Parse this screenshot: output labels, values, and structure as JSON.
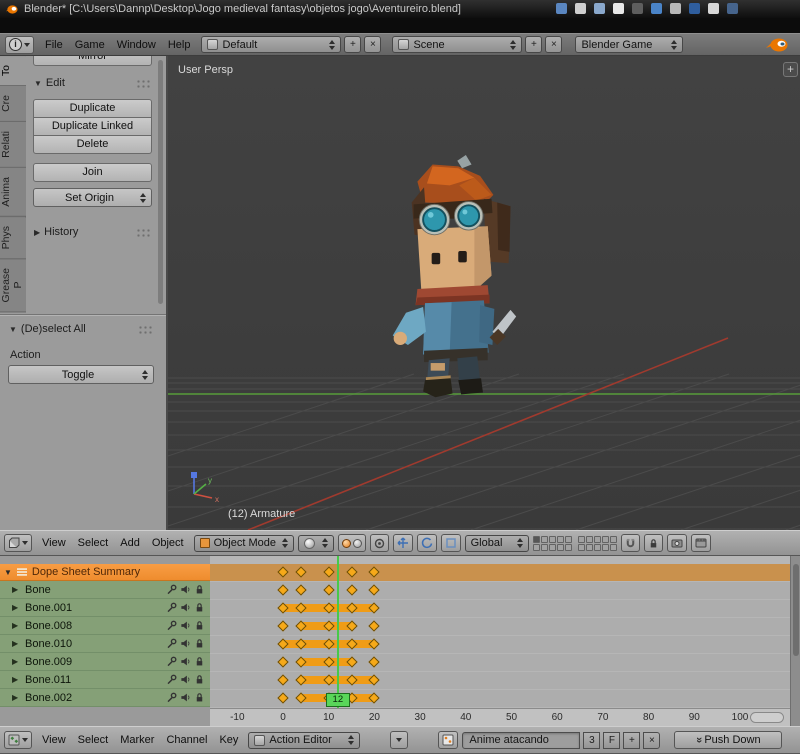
{
  "icons": {
    "expanded": "▼",
    "collapsed": "▶",
    "plus": "+",
    "close": "×",
    "push_down_arrow": "»",
    "info": "i",
    "region_plus": "+"
  },
  "titlebar": {
    "title": "Blender* [C:\\Users\\Dannp\\Desktop\\Jogo medieval fantasy\\objetos jogo\\Aventureiro.blend]"
  },
  "infobar": {
    "menus": [
      "File",
      "Game",
      "Window",
      "Help"
    ],
    "layout_value": "Default",
    "scene_value": "Scene",
    "engine_value": "Blender Game"
  },
  "toolshelf": {
    "tabs": [
      {
        "label": "To",
        "active": true
      },
      {
        "label": "Cre",
        "active": false
      },
      {
        "label": "Relati",
        "active": false
      },
      {
        "label": "Anima",
        "active": false
      },
      {
        "label": "Phys",
        "active": false
      },
      {
        "label": "Grease P",
        "active": false
      }
    ],
    "mirror_button": "Mirror",
    "edit_panel_title": "Edit",
    "edit_buttons": [
      "Duplicate",
      "Duplicate Linked",
      "Delete"
    ],
    "join_button": "Join",
    "set_origin_button": "Set Origin",
    "history_panel_title": "History",
    "redo_panel_title": "(De)select All",
    "action_label": "Action",
    "toggle_value": "Toggle"
  },
  "viewport": {
    "view_label": "User Persp",
    "active_object_label": "(12) Armature",
    "header": {
      "menus": [
        "View",
        "Select",
        "Add",
        "Object"
      ],
      "mode_value": "Object Mode",
      "orientation_value": "Global"
    }
  },
  "dopesheet": {
    "summary_label": "Dope Sheet Summary",
    "summary_keys": [
      0,
      4,
      10,
      15,
      20
    ],
    "channels": [
      {
        "label": "Bone",
        "keys": [
          0,
          4,
          10,
          15,
          20
        ],
        "band": null
      },
      {
        "label": "Bone.001",
        "keys": [
          0,
          4,
          10,
          15,
          20
        ],
        "band": [
          0,
          20
        ]
      },
      {
        "label": "Bone.008",
        "keys": [
          0,
          4,
          10,
          15,
          20
        ],
        "band": [
          4,
          15
        ]
      },
      {
        "label": "Bone.010",
        "keys": [
          0,
          4,
          10,
          15,
          20
        ],
        "band": [
          0,
          20
        ]
      },
      {
        "label": "Bone.009",
        "keys": [
          0,
          4,
          10,
          15,
          20
        ],
        "band": [
          4,
          15
        ]
      },
      {
        "label": "Bone.011",
        "keys": [
          0,
          4,
          10,
          15,
          20
        ],
        "band": [
          4,
          20
        ]
      },
      {
        "label": "Bone.002",
        "keys": [
          0,
          4,
          10,
          15,
          20
        ],
        "band": [
          4,
          20
        ]
      }
    ],
    "current_frame": "12",
    "ruler_ticks": [
      "-10",
      "0",
      "10",
      "20",
      "30",
      "40",
      "50",
      "60",
      "70",
      "80",
      "90",
      "100"
    ],
    "header": {
      "menus": [
        "View",
        "Select",
        "Marker",
        "Channel",
        "Key"
      ],
      "editor_mode": "Action Editor",
      "action_name": "Anime atacando",
      "users_count": "3",
      "fake_user": "F",
      "push_down": "Push Down"
    }
  }
}
